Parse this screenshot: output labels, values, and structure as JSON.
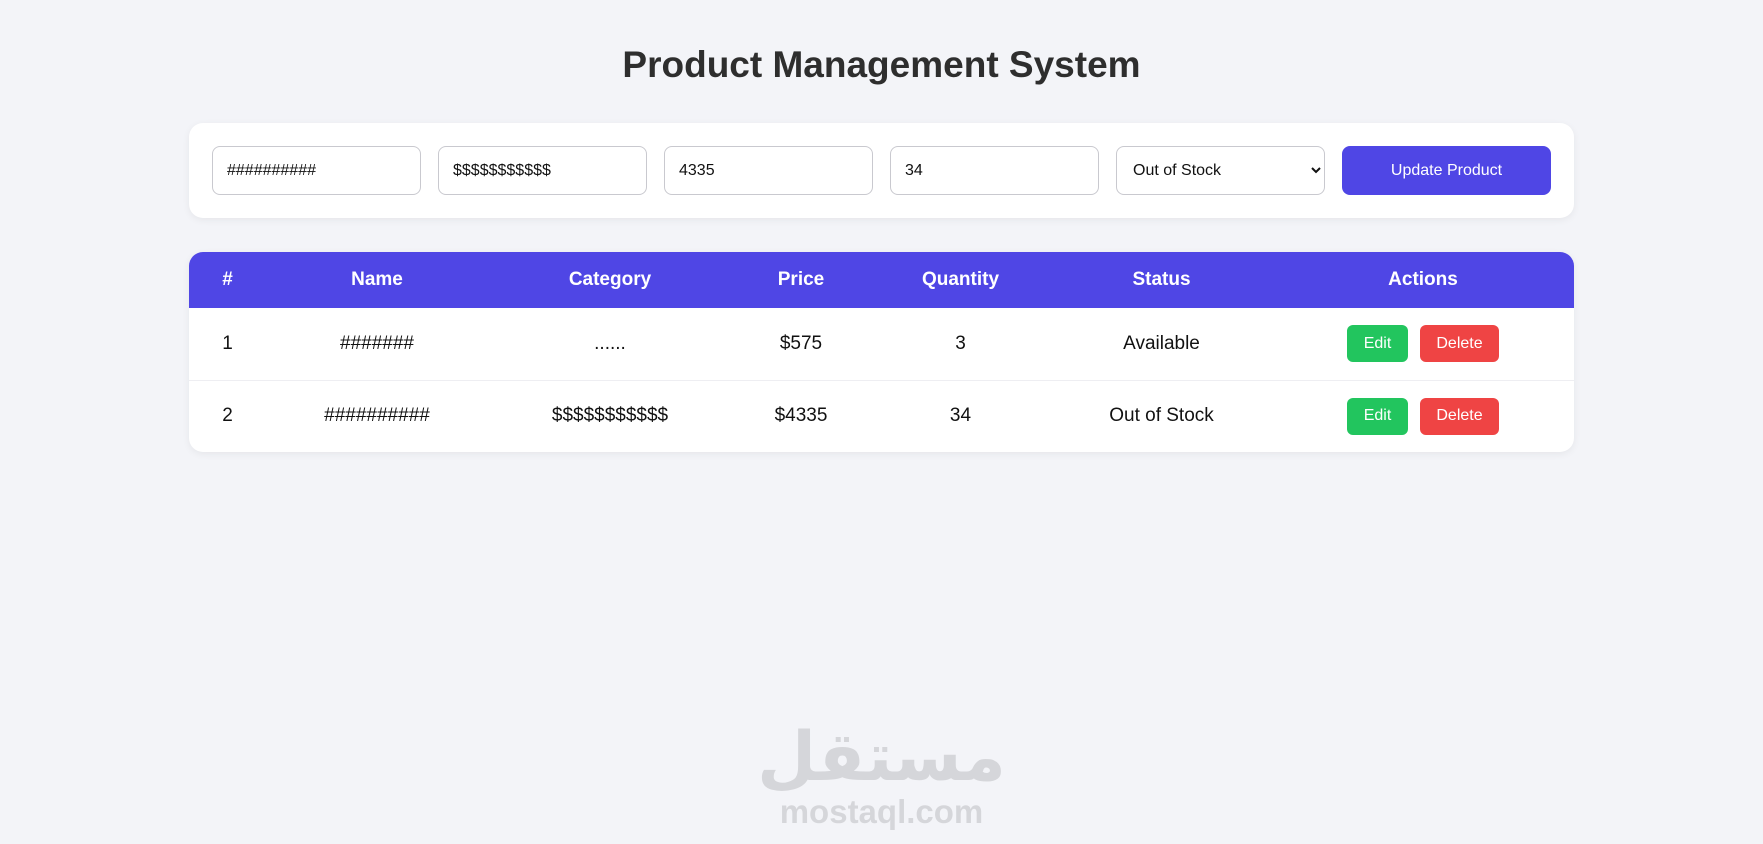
{
  "page": {
    "title": "Product Management System"
  },
  "form": {
    "name_value": "##########",
    "category_value": "$$$$$$$$$$$",
    "price_value": "4335",
    "quantity_value": "34",
    "status_selected": "Out of Stock",
    "submit_label": "Update Product"
  },
  "table": {
    "headers": [
      "#",
      "Name",
      "Category",
      "Price",
      "Quantity",
      "Status",
      "Actions"
    ],
    "rows": [
      {
        "index": "1",
        "name": "#######",
        "category": "......",
        "price": "$575",
        "quantity": "3",
        "status": "Available",
        "edit_label": "Edit",
        "delete_label": "Delete"
      },
      {
        "index": "2",
        "name": "##########",
        "category": "$$$$$$$$$$$",
        "price": "$4335",
        "quantity": "34",
        "status": "Out of Stock",
        "edit_label": "Edit",
        "delete_label": "Delete"
      }
    ]
  },
  "watermark": {
    "arabic": "مستقل",
    "latin": "mostaql.com"
  },
  "colors": {
    "primary": "#4f46e5",
    "edit": "#22c55e",
    "delete": "#ef4444",
    "background": "#f3f4f8"
  }
}
